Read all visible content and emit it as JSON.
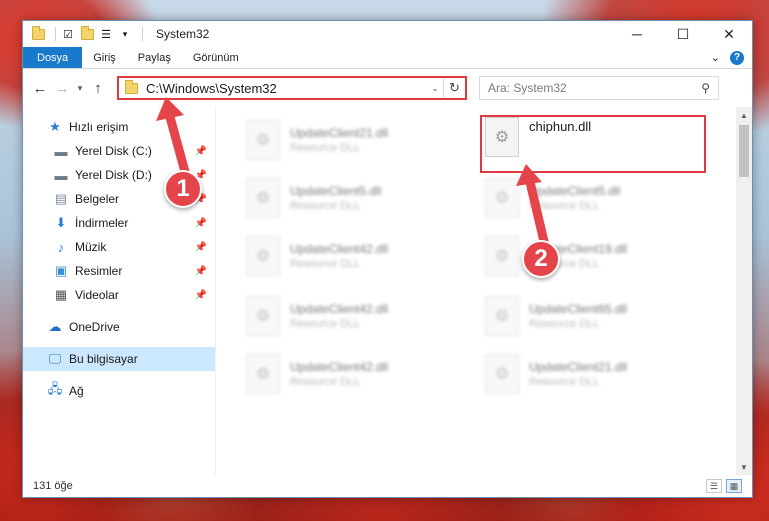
{
  "window": {
    "title": "System32",
    "controls": {
      "minimize": "─",
      "maximize": "☐",
      "close": "✕"
    }
  },
  "ribbon": {
    "tabs": [
      "Dosya",
      "Giriş",
      "Paylaş",
      "Görünüm"
    ],
    "help": "?"
  },
  "nav": {
    "address": "C:\\Windows\\System32",
    "search_placeholder": "Ara: System32"
  },
  "sidebar": {
    "items": [
      {
        "label": "Hızlı erişim",
        "icon": "star-icon",
        "pinned": false
      },
      {
        "label": "Yerel Disk (C:)",
        "icon": "drive-icon",
        "pinned": true
      },
      {
        "label": "Yerel Disk (D:)",
        "icon": "drive-icon",
        "pinned": true
      },
      {
        "label": "Belgeler",
        "icon": "document-icon",
        "pinned": true
      },
      {
        "label": "İndirmeler",
        "icon": "download-icon",
        "pinned": true
      },
      {
        "label": "Müzik",
        "icon": "music-icon",
        "pinned": true
      },
      {
        "label": "Resimler",
        "icon": "pictures-icon",
        "pinned": true
      },
      {
        "label": "Videolar",
        "icon": "video-icon",
        "pinned": true
      },
      {
        "label": "OneDrive",
        "icon": "cloud-icon",
        "pinned": false
      },
      {
        "label": "Bu bilgisayar",
        "icon": "computer-icon",
        "pinned": false
      },
      {
        "label": "Ağ",
        "icon": "network-icon",
        "pinned": false
      }
    ]
  },
  "files": {
    "left": [
      {
        "name": "UpdateClient21.dll",
        "desc": "Resource DLL"
      },
      {
        "name": "UpdateClient5.dll",
        "desc": "Resource DLL"
      },
      {
        "name": "UpdateClient42.dll",
        "desc": "Resource DLL"
      },
      {
        "name": "UpdateClient42.dll",
        "desc": "Resource DLL"
      },
      {
        "name": "UpdateClient42.dll",
        "desc": "Resource DLL"
      }
    ],
    "right": [
      {
        "name": "chiphun.dll",
        "desc": ""
      },
      {
        "name": "UpdateClient5.dll",
        "desc": "Resource DLL"
      },
      {
        "name": "UpdateClient19.dll",
        "desc": "Resource DLL"
      },
      {
        "name": "UpdateClient65.dll",
        "desc": "Resource DLL"
      },
      {
        "name": "UpdateClient21.dll",
        "desc": "Resource DLL"
      }
    ]
  },
  "status": {
    "count": "131 öğe"
  },
  "annotations": {
    "badge1": "1",
    "badge2": "2",
    "color": "#e4444a"
  }
}
